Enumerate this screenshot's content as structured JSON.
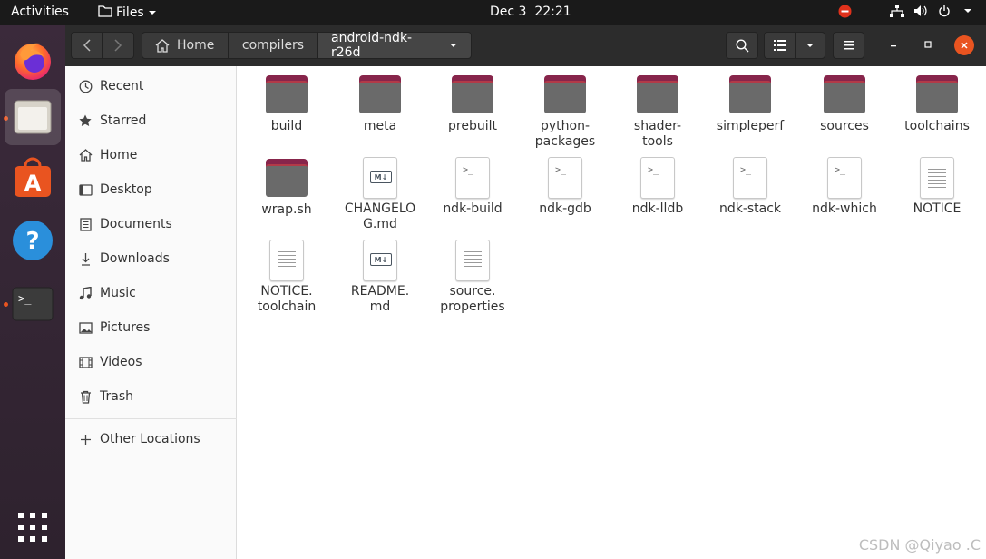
{
  "topbar": {
    "activities": "Activities",
    "app_menu": "Files",
    "clock_date": "Dec 3",
    "clock_time": "22:21"
  },
  "dock": {
    "items": [
      "firefox",
      "files",
      "software",
      "help",
      "terminal",
      "show-apps"
    ]
  },
  "headerbar": {
    "path": [
      "Home",
      "compilers",
      "android-ndk-r26d"
    ]
  },
  "sidebar": {
    "items": [
      {
        "label": "Recent",
        "icon": "clock-icon"
      },
      {
        "label": "Starred",
        "icon": "star-icon"
      },
      {
        "label": "Home",
        "icon": "home-icon"
      },
      {
        "label": "Desktop",
        "icon": "desktop-icon"
      },
      {
        "label": "Documents",
        "icon": "document-icon"
      },
      {
        "label": "Downloads",
        "icon": "download-icon"
      },
      {
        "label": "Music",
        "icon": "music-icon"
      },
      {
        "label": "Pictures",
        "icon": "picture-icon"
      },
      {
        "label": "Videos",
        "icon": "video-icon"
      },
      {
        "label": "Trash",
        "icon": "trash-icon"
      }
    ],
    "other_locations": "Other Locations"
  },
  "files": [
    {
      "name": "build",
      "type": "folder"
    },
    {
      "name": "meta",
      "type": "folder"
    },
    {
      "name": "prebuilt",
      "type": "folder"
    },
    {
      "name": "python-\npackages",
      "type": "folder"
    },
    {
      "name": "shader-\ntools",
      "type": "folder"
    },
    {
      "name": "simpleperf",
      "type": "folder"
    },
    {
      "name": "sources",
      "type": "folder"
    },
    {
      "name": "toolchains",
      "type": "folder"
    },
    {
      "name": "wrap.sh",
      "type": "folder"
    },
    {
      "name": "CHANGELO\nG.md",
      "type": "markdown"
    },
    {
      "name": "ndk-build",
      "type": "script"
    },
    {
      "name": "ndk-gdb",
      "type": "script"
    },
    {
      "name": "ndk-lldb",
      "type": "script"
    },
    {
      "name": "ndk-stack",
      "type": "script"
    },
    {
      "name": "ndk-which",
      "type": "script"
    },
    {
      "name": "NOTICE",
      "type": "text"
    },
    {
      "name": "NOTICE.\ntoolchain",
      "type": "text"
    },
    {
      "name": "README.\nmd",
      "type": "markdown"
    },
    {
      "name": "source.\nproperties",
      "type": "text"
    }
  ],
  "watermark": "CSDN @Qiyao .C",
  "colors": {
    "accent": "#e95420",
    "close": "#e95420",
    "folder_tab": "#87254b"
  }
}
